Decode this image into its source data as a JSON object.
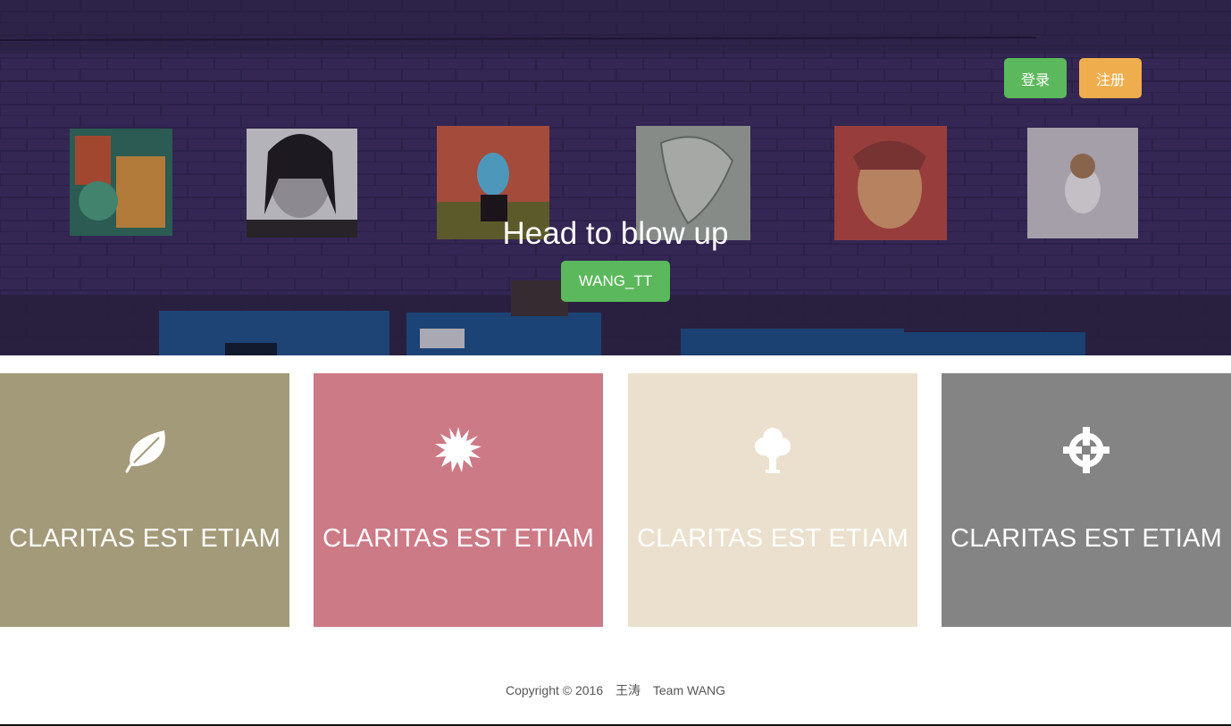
{
  "hero": {
    "title": "Head to blow up",
    "cta_label": "WANG_TT",
    "login_label": "登录",
    "register_label": "注册"
  },
  "cards": [
    {
      "title": "CLARITAS EST ETIAM",
      "icon": "leaf-icon",
      "color": "#a39a7a"
    },
    {
      "title": "CLARITAS EST ETIAM",
      "icon": "starburst-icon",
      "color": "#cc7a86"
    },
    {
      "title": "CLARITAS EST ETIAM",
      "icon": "tree-icon",
      "color": "#eae0cd"
    },
    {
      "title": "CLARITAS EST ETIAM",
      "icon": "crosshair-icon",
      "color": "#848484"
    }
  ],
  "footer": {
    "copyright": "Copyright © 2016",
    "author": "王涛",
    "team": "Team WANG"
  },
  "colors": {
    "success": "#5cb85c",
    "warning": "#f0ad4e",
    "hero_background": "#2f2547"
  }
}
